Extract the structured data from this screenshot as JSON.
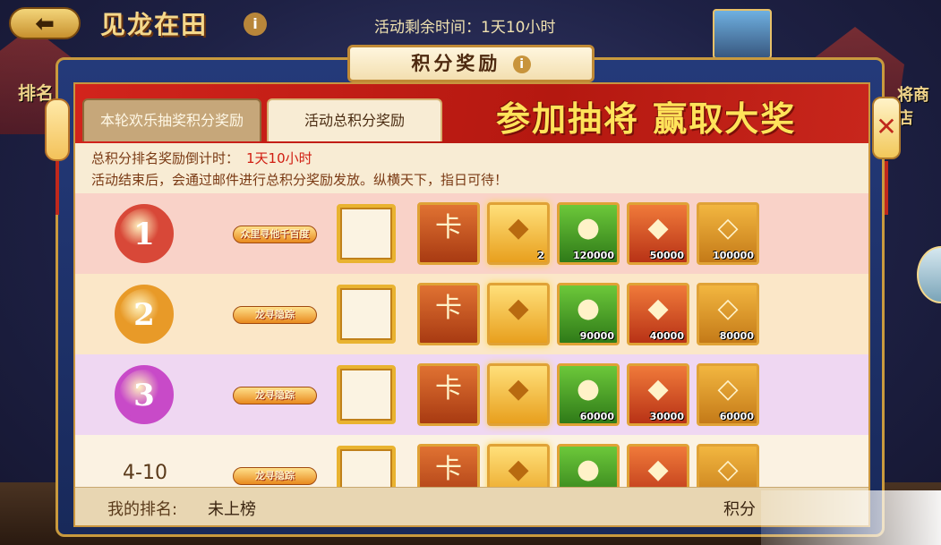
{
  "top": {
    "back_glyph": "⬅",
    "game_title": "见龙在田",
    "info_glyph": "i",
    "time_left": "活动剩余时间：1天10小时"
  },
  "sides": {
    "left_label": "排名",
    "right_label": "将商店"
  },
  "window": {
    "title": "积分奖励",
    "title_info": "i",
    "close_glyph": "✕",
    "banner": "参加抽将  赢取大奖",
    "tabs": [
      {
        "label": "本轮欢乐抽奖积分奖励",
        "active": false
      },
      {
        "label": "活动总积分奖励",
        "active": true
      }
    ],
    "countdown_label": "总积分排名奖励倒计时：",
    "countdown_value": "1天10小时",
    "notice": "活动结束后，会通过邮件进行总积分奖励发放。纵横天下，指日可待！"
  },
  "rows": [
    {
      "rank": "1",
      "rank_color": "#d84838",
      "bg": "#f9d2c8",
      "title_badge": "众里寻他千百度",
      "items": [
        {
          "icon": "card-icon",
          "glyph": "卡",
          "qty": ""
        },
        {
          "icon": "chest-icon",
          "glyph": "◆",
          "qty": "2"
        },
        {
          "icon": "jade-icon",
          "glyph": "●",
          "qty": "120000"
        },
        {
          "icon": "ruby-icon",
          "glyph": "◆",
          "qty": "50000"
        },
        {
          "icon": "token-icon",
          "glyph": "◇",
          "qty": "100000"
        }
      ]
    },
    {
      "rank": "2",
      "rank_color": "#e89a28",
      "bg": "#fbe7c8",
      "title_badge": "龙寻隐踪",
      "items": [
        {
          "icon": "card-icon",
          "glyph": "卡",
          "qty": ""
        },
        {
          "icon": "chest-icon",
          "glyph": "◆",
          "qty": ""
        },
        {
          "icon": "jade-icon",
          "glyph": "●",
          "qty": "90000"
        },
        {
          "icon": "ruby-icon",
          "glyph": "◆",
          "qty": "40000"
        },
        {
          "icon": "token-icon",
          "glyph": "◇",
          "qty": "80000"
        }
      ]
    },
    {
      "rank": "3",
      "rank_color": "#c84ac8",
      "bg": "#efd7f2",
      "title_badge": "龙寻隐踪",
      "items": [
        {
          "icon": "card-icon",
          "glyph": "卡",
          "qty": ""
        },
        {
          "icon": "chest-icon",
          "glyph": "◆",
          "qty": ""
        },
        {
          "icon": "jade-icon",
          "glyph": "●",
          "qty": "60000"
        },
        {
          "icon": "ruby-icon",
          "glyph": "◆",
          "qty": "30000"
        },
        {
          "icon": "token-icon",
          "glyph": "◇",
          "qty": "60000"
        }
      ]
    },
    {
      "rank": "4-10",
      "rank_color": "",
      "bg": "#fbf2e2",
      "title_badge": "龙寻隐踪",
      "items": [
        {
          "icon": "card-icon",
          "glyph": "卡",
          "qty": ""
        },
        {
          "icon": "chest-icon",
          "glyph": "◆",
          "qty": ""
        },
        {
          "icon": "jade-icon",
          "glyph": "●",
          "qty": ""
        },
        {
          "icon": "ruby-icon",
          "glyph": "◆",
          "qty": ""
        },
        {
          "icon": "token-icon",
          "glyph": "◇",
          "qty": ""
        }
      ]
    }
  ],
  "footer": {
    "my_rank_label": "我的排名:",
    "my_rank_value": "未上榜",
    "score_label": "积分"
  }
}
